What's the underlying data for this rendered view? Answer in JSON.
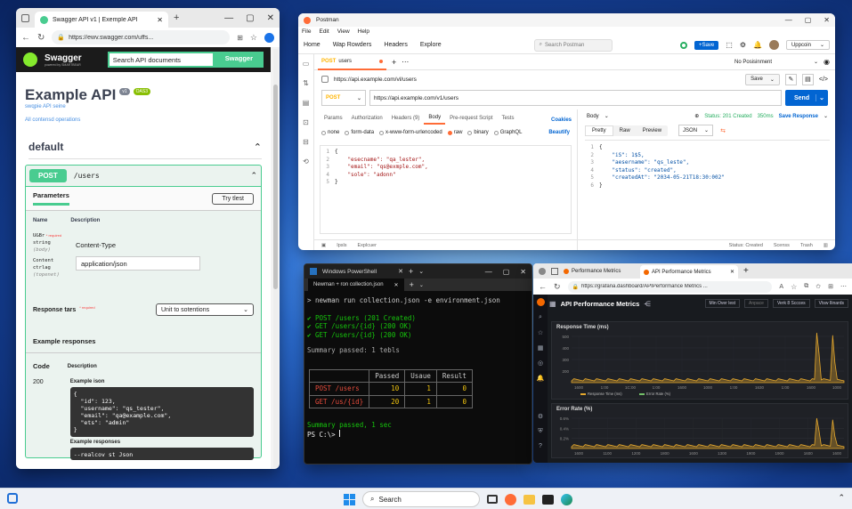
{
  "swagger": {
    "tab_title": "Swagger API v1 | Exemple API",
    "url": "https://ewv.swagger.com/uffs...",
    "logo": "Swagger",
    "logo_sub": "powered by SMARTBEAR",
    "search_placeholder": "Search API documents",
    "search_button": "Swagger",
    "title": "Example API",
    "version": "v1",
    "oas": "OAS3",
    "subtitle": "swqpie API seine",
    "ops_link": "All contensd operations",
    "section": "default",
    "method": "POST",
    "path": "/users",
    "params_tab": "Parameters",
    "try_button": "Try tlest",
    "col_name": "Name",
    "col_desc": "Description",
    "param_name": "U&Br",
    "param_req": "* required",
    "param_type": "string",
    "param_in": "(body)",
    "param2_name": "Content",
    "param2_type": "ctrlag",
    "param2_in": "(topenet)",
    "content_type_label": "Content-Type",
    "content_type_value": "application/json",
    "response_label": "Response tars",
    "response_req": "* required",
    "response_select": "Unit to sotentions",
    "example_responses": "Example responses",
    "code_head": "Code",
    "desc_head": "Description",
    "code_200": "200",
    "example_json": "Example ison",
    "json_lines": [
      "{",
      "  \"id\": 123,",
      "  \"username\": \"qs_tester\",",
      "  \"email\": \"qa@example.com\",",
      "  \"ets\": \"admin\"",
      "}"
    ],
    "example_responses2": "Example responses",
    "code2_line": "--realcov st Json"
  },
  "postman": {
    "app_title": "Postman",
    "menu": [
      "File",
      "Edit",
      "View",
      "Help"
    ],
    "nav": [
      "Home",
      "Wap Rowders",
      "Headers",
      "Explore"
    ],
    "search_placeholder": "Search Postman",
    "save_label": "Save",
    "upgrade_label": "Uppcoin",
    "tab_method": "POST",
    "tab_name": "users",
    "env_select": "No Posisinment",
    "breadcrumb_url": "https://api.example.com/vl/users",
    "save2": "Save",
    "method": "POST",
    "request_url": "https://api.example.com/v1/users",
    "send": "Send",
    "req_tabs": [
      "Params",
      "Authorization",
      "Headers (9)",
      "Body",
      "Pre-request Script",
      "Tests"
    ],
    "cookies": "Coakies",
    "body_opts": [
      "none",
      "form-data",
      "x-www-form-urlencoded",
      "raw",
      "binary",
      "GraphQL"
    ],
    "beautify": "Beautify",
    "req_body": [
      "{",
      "    \"esecname\": \"qa_lester\",",
      "    \"email\": \"qs@exmple.com\",",
      "    \"sole\": \"adonn\"",
      "}"
    ],
    "resp_label": "Body",
    "status": "Status: 201 Created",
    "time": "350ms",
    "save_response": "Save Response",
    "resp_tabs": [
      "Pretty",
      "Raw",
      "Preview"
    ],
    "resp_format": "JSON",
    "resp_body": [
      "{",
      "    \"iS\": 1$5,",
      "    \"aesername\": \"qs_leste\",",
      "    \"status\": \"created\",",
      "    \"createdAt\": \"2034-05-21T18:30:002\"",
      "}"
    ],
    "footer_left": [
      "Ipsls",
      "Explcuer"
    ],
    "footer_right": [
      "Status: Created",
      "Scenss",
      "Trash"
    ]
  },
  "terminal": {
    "title": "Windows PowerShell",
    "tab": "Newman + ron collection.json",
    "command": "newman run collection.json -e environment.json",
    "results": [
      "✔ POST /users (201 Created)",
      "✔ GET /users/{id} (200 OK)",
      "✔ GET /users/{id} (200 OK)"
    ],
    "summary1": "Summary passed: 1 tebls",
    "table_head": [
      "",
      "Passed",
      "Usaue",
      "Result"
    ],
    "table_rows": [
      [
        "POST /users",
        "10",
        "1",
        "0"
      ],
      [
        "GET /us/{id}",
        "20",
        "1",
        "0"
      ]
    ],
    "summary2": "Summary passed, 1 sec",
    "prompt": "PS C:\\>"
  },
  "grafana": {
    "tab1": "Performance Metrics",
    "tab2": "API Performance Metrics",
    "url": "https://grafana.dashboard/APIPerformance Metrics ...",
    "dash_title": "API Performance Metrics",
    "controls": [
      "Min Over lest",
      "Anpace",
      "Verk 8 Sccces",
      "Vtsw Ilinards"
    ],
    "panel1_title": "Response Time (ms)",
    "panel1_yticks": [
      "500",
      "400",
      "300",
      "200"
    ],
    "panel1_xticks": [
      "1600",
      "1:00",
      "1C:00",
      "1:00",
      "1600",
      "1000",
      "1:00",
      "1630",
      "1:00",
      "1600",
      "1000"
    ],
    "panel1_legend": [
      "Response Time (ms)",
      "Error Rate (%)"
    ],
    "panel2_title": "Error Rate (%)",
    "panel2_yticks": [
      "0.6%",
      "0.4%",
      "0.2%"
    ],
    "panel2_xticks": [
      "1600",
      "1100",
      "1200",
      "1800",
      "1600",
      "1300",
      "1900",
      "1900",
      "1600",
      "1600"
    ]
  },
  "taskbar": {
    "search": "Search"
  },
  "colors": {
    "swagger_green": "#49cc90",
    "postman_orange": "#ff6c37",
    "send_blue": "#0265d2",
    "terminal_green": "#16c60c",
    "grafana_line": "#e5a82d"
  }
}
